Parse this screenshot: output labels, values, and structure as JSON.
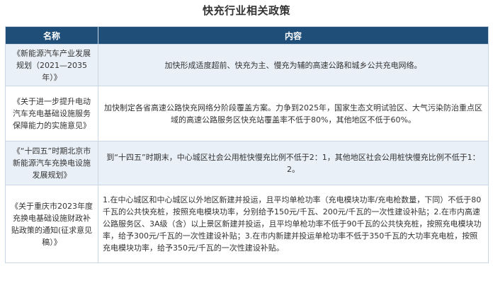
{
  "title": "快充行业相关政策",
  "table": {
    "headers": [
      "名称",
      "内容"
    ],
    "rows": [
      {
        "name": "《新能源汽车产业发展规划（2021—2035年）》",
        "content": "加快形成适度超前、快充为主、慢充为辅的高速公路和城乡公共充电网络。"
      },
      {
        "name": "《关于进一步提升电动汽车充电基础设施服务保障能力的实施意见》",
        "content": "加快制定各省高速公路快充网络分阶段覆盖方案。力争到2025年，国家生态文明试验区、大气污染防治重点区域的高速公路服务区快充站覆盖率不低于80%，其他地区不低于60%。"
      },
      {
        "name": "《“十四五”时期北京市新能源汽车充换电设施发展规划》",
        "content": "到“十四五”时期末，中心城区社会公用桩快慢充比例不低于2：1，其他地区社会公用桩快慢充比例不低于1：2。"
      },
      {
        "name": "《关于重庆市2023年度充换电基础设施财政补贴政策的通知(征求意见稿）》",
        "content": "1.在中心城区和中心城区以外地区新建并投运，且平均单枪功率（充电模块功率/充电枪数量，下同）不低于80千瓦的公共快充桩，按照充电模块功率，分别给予150元/千瓦、200元/千瓦的一次性建设补贴；2.在市内高速公路服务区、3A级（含）以上景区新建并投运，且平均单枪功率不低于90千瓦的公共快充桩，按照充电模块功率，给予300元/千瓦的一次性建设补贴；3.在市内新建并投运单枪功率不低于350千瓦的大功率充电桩，按照充电模块功率，给予350元/千瓦的一次性建设补贴。"
      }
    ]
  }
}
